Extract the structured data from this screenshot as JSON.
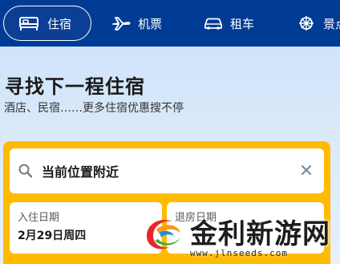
{
  "nav": {
    "tabs": [
      {
        "label": "住宿",
        "icon": "bed-icon",
        "active": true
      },
      {
        "label": "机票",
        "icon": "plane-icon",
        "active": false
      },
      {
        "label": "租车",
        "icon": "car-icon",
        "active": false
      },
      {
        "label": "景点",
        "icon": "attraction-icon",
        "active": false
      }
    ]
  },
  "hero": {
    "title": "寻找下一程住宿",
    "subtitle": "酒店、民宿……更多住宿优惠搜不停"
  },
  "search": {
    "location": "当前位置附近",
    "checkin_label": "入住日期",
    "checkin_value": "2月29日周四",
    "checkout_label": "退房日期"
  },
  "watermark": {
    "name": "金利新游网",
    "url": "www.jlnseeds.com"
  },
  "colors": {
    "nav_bg": "#003c95",
    "card_yellow": "#febb02",
    "hero_bg": "#cfe3fa"
  }
}
